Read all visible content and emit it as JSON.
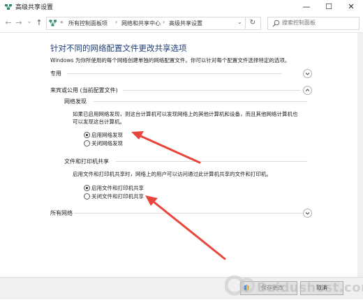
{
  "window": {
    "title": "高级共享设置",
    "min_glyph": "—",
    "max_glyph": "☐",
    "close_glyph": "✕"
  },
  "nav": {
    "back": "←",
    "forward": "→",
    "dropdown": "⌄",
    "up": "↑"
  },
  "address": {
    "prefix": "«",
    "crumbs": [
      "所有控制面板项",
      "网络和共享中心",
      "高级共享设置"
    ],
    "separator": "›",
    "dropdown": "⌄",
    "refresh": "↻"
  },
  "search": {
    "placeholder": "搜索控制面板"
  },
  "page": {
    "heading": "针对不同的网络配置文件更改共享选项",
    "description": "Windows 为你所使用的每个网络创建单独的网络配置文件。你可以针对每个配置文件选择特定的选项。"
  },
  "profiles": {
    "private": {
      "label": "专用",
      "expanded": false
    },
    "guest": {
      "label": "来宾或公用 (当前配置文件)",
      "expanded": true
    },
    "all": {
      "label": "所有网络",
      "expanded": false
    }
  },
  "network_discovery": {
    "title": "网络发现",
    "para1": "如果已启用网络发现，则这台计算机可以发现网络上的其他计算机和设备，而且其他网络计算机也",
    "para2": "可以发现这台计算机。",
    "opt_on": "启用网络发现",
    "opt_off": "关闭网络发现",
    "selected": "on"
  },
  "file_sharing": {
    "title": "文件和打印机共享",
    "para": "启用文件和打印机共享时，网络上的用户可以访问通过此计算机共享的文件和打印机。",
    "opt_on": "启用文件和打印机共享",
    "opt_off": "关闭文件和打印机共享",
    "selected": "on"
  },
  "footer": {
    "save_label": "保存更改",
    "cancel_label": "取消"
  },
  "watermark": {
    "text": "Baidushest.com"
  },
  "colors": {
    "heading": "#1f3e78",
    "arrow": "#e8453c"
  }
}
